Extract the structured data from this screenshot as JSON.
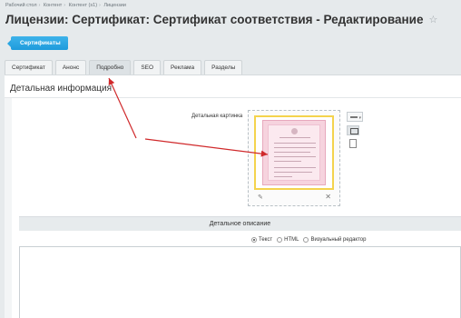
{
  "breadcrumb": [
    "Рабочий стол",
    "Контент",
    "Контент (s1)",
    "Лицензии"
  ],
  "page": {
    "title": "Лицензии: Сертификат: Сертификат соответствия - Редактирование"
  },
  "context_button": "Сертификаты",
  "tabs": [
    {
      "label": "Сертификат",
      "active": false
    },
    {
      "label": "Анонс",
      "active": false
    },
    {
      "label": "Подробно",
      "active": true
    },
    {
      "label": "SEO",
      "active": false
    },
    {
      "label": "Реклама",
      "active": false
    },
    {
      "label": "Разделы",
      "active": false
    }
  ],
  "detail": {
    "section_title": "Детальная информация",
    "picture_label": "Детальная картинка",
    "description_header": "Детальное описание",
    "editor_modes": [
      {
        "label": "Текст",
        "selected": true
      },
      {
        "label": "HTML",
        "selected": false
      },
      {
        "label": "Визуальный редактор",
        "selected": false
      }
    ]
  },
  "colors": {
    "accent": "#2aa6e2",
    "annotation_arrow": "#d0292b",
    "image_border": "#f4d34d"
  },
  "icons": [
    "star-icon",
    "pencil-icon",
    "close-icon",
    "menu-icon",
    "image-icon",
    "file-icon"
  ]
}
